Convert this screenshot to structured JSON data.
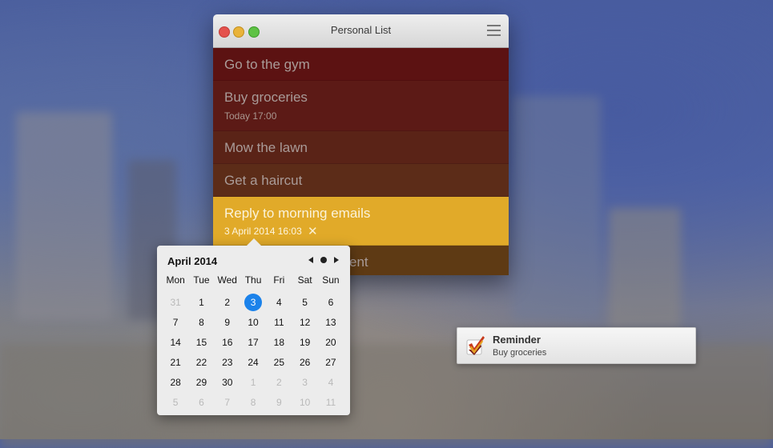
{
  "window": {
    "title": "Personal List"
  },
  "tasks": [
    {
      "title": "Go to the gym",
      "date": ""
    },
    {
      "title": "Buy groceries",
      "date": "Today 17:00"
    },
    {
      "title": "Mow the lawn",
      "date": ""
    },
    {
      "title": "Get a haircut",
      "date": ""
    },
    {
      "title": "Reply to morning emails",
      "date": "3 April 2014 16:03",
      "clear_icon": "✕"
    },
    {
      "title": "ent",
      "date": ""
    }
  ],
  "calendar": {
    "month_label": "April 2014",
    "weekdays": [
      "Mon",
      "Tue",
      "Wed",
      "Thu",
      "Fri",
      "Sat",
      "Sun"
    ],
    "weeks": [
      [
        "31",
        "1",
        "2",
        "3",
        "4",
        "5",
        "6"
      ],
      [
        "7",
        "8",
        "9",
        "10",
        "11",
        "12",
        "13"
      ],
      [
        "14",
        "15",
        "16",
        "17",
        "18",
        "19",
        "20"
      ],
      [
        "21",
        "22",
        "23",
        "24",
        "25",
        "26",
        "27"
      ],
      [
        "28",
        "29",
        "30",
        "1",
        "2",
        "3",
        "4"
      ],
      [
        "5",
        "6",
        "7",
        "8",
        "9",
        "10",
        "11"
      ]
    ],
    "selected_day": "3",
    "selected_color": "#1b82ea"
  },
  "notification": {
    "title": "Reminder",
    "body": "Buy groceries",
    "icon": "checkmark-app-icon"
  },
  "colors": {
    "task_highlight": "#e1aa29",
    "task_red": "#5c1212"
  }
}
